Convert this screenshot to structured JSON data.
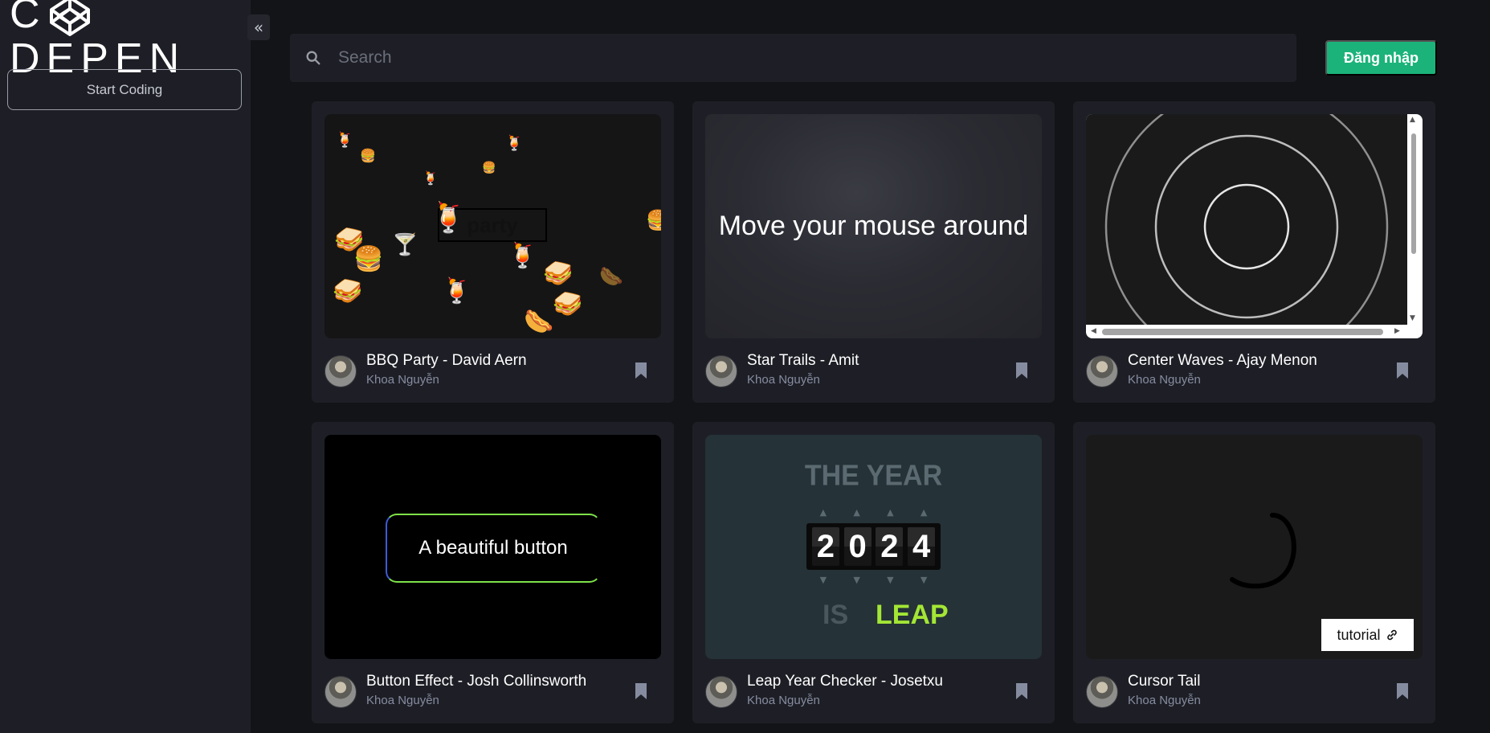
{
  "sidebar": {
    "logo_text": "CODEPEN",
    "logo_left": "C",
    "logo_right": "DEPEN",
    "start_coding_label": "Start Coding"
  },
  "header": {
    "search_placeholder": "Search",
    "login_label": "Đăng nhập"
  },
  "cards": [
    {
      "title": "BBQ Party - David Aern",
      "author": "Khoa Nguyễn",
      "preview_text": "party"
    },
    {
      "title": "Star Trails - Amit",
      "author": "Khoa Nguyễn",
      "preview_text": "Move your mouse around"
    },
    {
      "title": "Center Waves - Ajay Menon",
      "author": "Khoa Nguyễn"
    },
    {
      "title": "Button Effect - Josh Collinsworth",
      "author": "Khoa Nguyễn",
      "preview_text": "A beautiful button"
    },
    {
      "title": "Leap Year Checker - Josetxu",
      "author": "Khoa Nguyễn",
      "preview_title": "THE YEAR",
      "preview_digits": [
        "2",
        "0",
        "2",
        "4"
      ],
      "preview_is": "IS",
      "preview_result": "LEAP"
    },
    {
      "title": "Cursor Tail",
      "author": "Khoa Nguyễn",
      "preview_button": "tutorial"
    }
  ],
  "colors": {
    "accent": "#1bb37a",
    "sidebar_bg": "#1e1f26",
    "page_bg": "#131417",
    "leap_green": "#a3e635"
  }
}
